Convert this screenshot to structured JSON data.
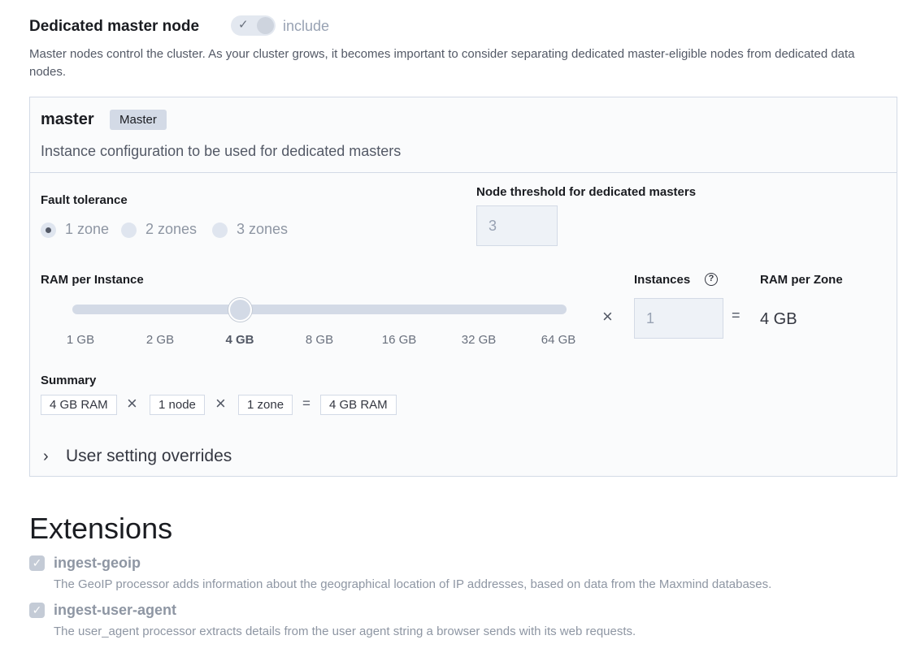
{
  "section": {
    "title": "Dedicated master node",
    "toggle_label": "include",
    "toggle_on": true,
    "description": "Master nodes control the cluster. As your cluster grows, it becomes important to consider separating dedicated master-eligible nodes from dedicated data nodes."
  },
  "panel": {
    "title": "master",
    "badge": "Master",
    "subtitle": "Instance configuration to be used for dedicated masters",
    "fault_tolerance": {
      "label": "Fault tolerance",
      "options": [
        "1 zone",
        "2 zones",
        "3 zones"
      ],
      "selected": "1 zone"
    },
    "node_threshold": {
      "label": "Node threshold for dedicated masters",
      "value": "3"
    },
    "ram": {
      "label": "RAM per Instance",
      "ticks": [
        "1 GB",
        "2 GB",
        "4 GB",
        "8 GB",
        "16 GB",
        "32 GB",
        "64 GB"
      ],
      "selected": "4 GB",
      "times": "×"
    },
    "instances": {
      "label": "Instances",
      "value": "1",
      "help_icon": "question-circle-icon",
      "equals": "="
    },
    "ram_per_zone": {
      "label": "RAM per Zone",
      "value": "4 GB"
    },
    "summary": {
      "label": "Summary",
      "ram": "4 GB RAM",
      "nodes": "1 node",
      "zones": "1 zone",
      "total": "4 GB RAM",
      "times": "×",
      "equals": "="
    },
    "overrides_label": "User setting overrides"
  },
  "extensions": {
    "title": "Extensions",
    "items": [
      {
        "name": "ingest-geoip",
        "checked": true,
        "description": "The GeoIP processor adds information about the geographical location of IP addresses, based on data from the Maxmind databases."
      },
      {
        "name": "ingest-user-agent",
        "checked": true,
        "description": "The user_agent processor extracts details from the user agent string a browser sends with its web requests."
      }
    ]
  }
}
